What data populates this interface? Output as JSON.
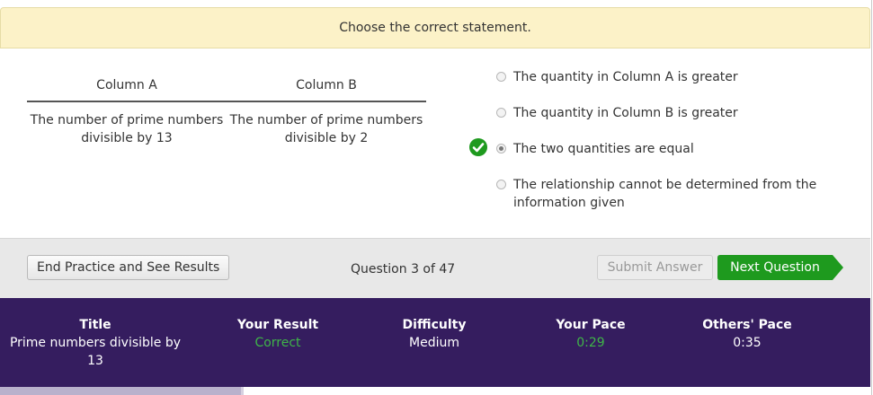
{
  "prompt": "Choose the correct statement.",
  "columns": {
    "a_header": "Column A",
    "b_header": "Column B",
    "a_value": "The number of prime numbers divisible by 13",
    "b_value": "The number of prime numbers divisible by 2"
  },
  "options": [
    {
      "label": "The quantity in Column A is greater",
      "selected": false
    },
    {
      "label": "The quantity in Column B is greater",
      "selected": false
    },
    {
      "label": "The two quantities are equal",
      "selected": true
    },
    {
      "label": "The relationship cannot be determined from the information given",
      "selected": false
    }
  ],
  "toolbar": {
    "end_label": "End Practice and See Results",
    "counter": "Question 3 of 47",
    "submit_label": "Submit Answer",
    "next_label": "Next Question"
  },
  "stats": {
    "title_label": "Title",
    "title_value": "Prime numbers divisible by 13",
    "result_label": "Your Result",
    "result_value": "Correct",
    "difficulty_label": "Difficulty",
    "difficulty_value": "Medium",
    "pace_label": "Your Pace",
    "pace_value": "0:29",
    "others_label": "Others' Pace",
    "others_value": "0:35"
  },
  "colors": {
    "prompt_bg": "#fcf2c8",
    "next_button": "#1e9a1e",
    "stats_bg": "#351d5f",
    "correct": "#3fb548"
  }
}
